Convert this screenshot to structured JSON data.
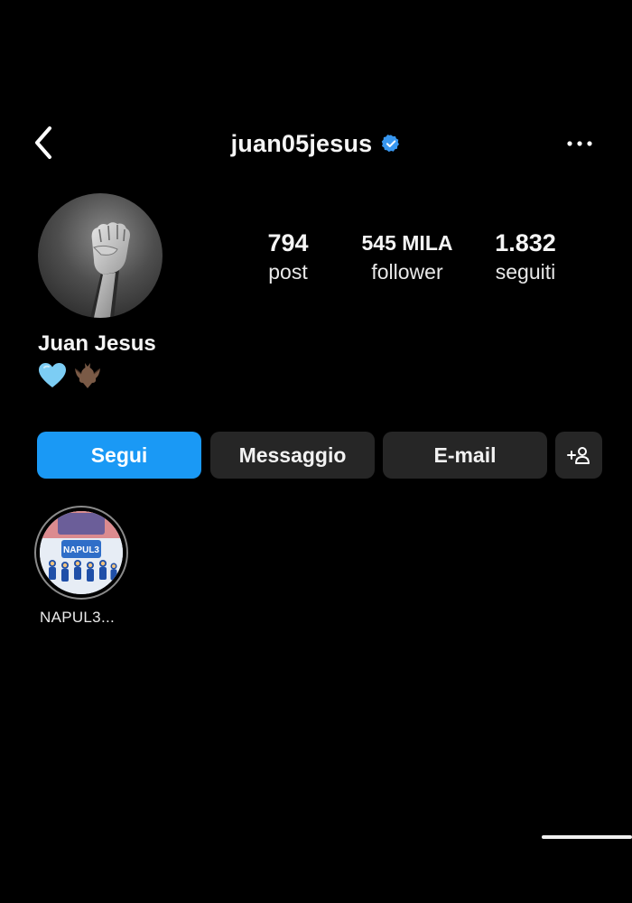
{
  "header": {
    "username": "juan05jesus",
    "verified_color": "#3897f0"
  },
  "profile": {
    "display_name": "Juan Jesus",
    "bio_emojis": [
      "light-blue-heart-emoji",
      "bat-emoji"
    ]
  },
  "stats": [
    {
      "value": "794",
      "label": "post"
    },
    {
      "value": "545 MILA",
      "label": "follower"
    },
    {
      "value": "1.832",
      "label": "seguiti"
    }
  ],
  "actions": {
    "follow_label": "Segui",
    "message_label": "Messaggio",
    "email_label": "E-mail",
    "add_user_icon": "add-user-icon"
  },
  "highlights": [
    {
      "label": "NAPUL3..."
    }
  ],
  "colors": {
    "background": "#000000",
    "follow_button": "#1a99f5",
    "secondary_button": "#262626"
  }
}
